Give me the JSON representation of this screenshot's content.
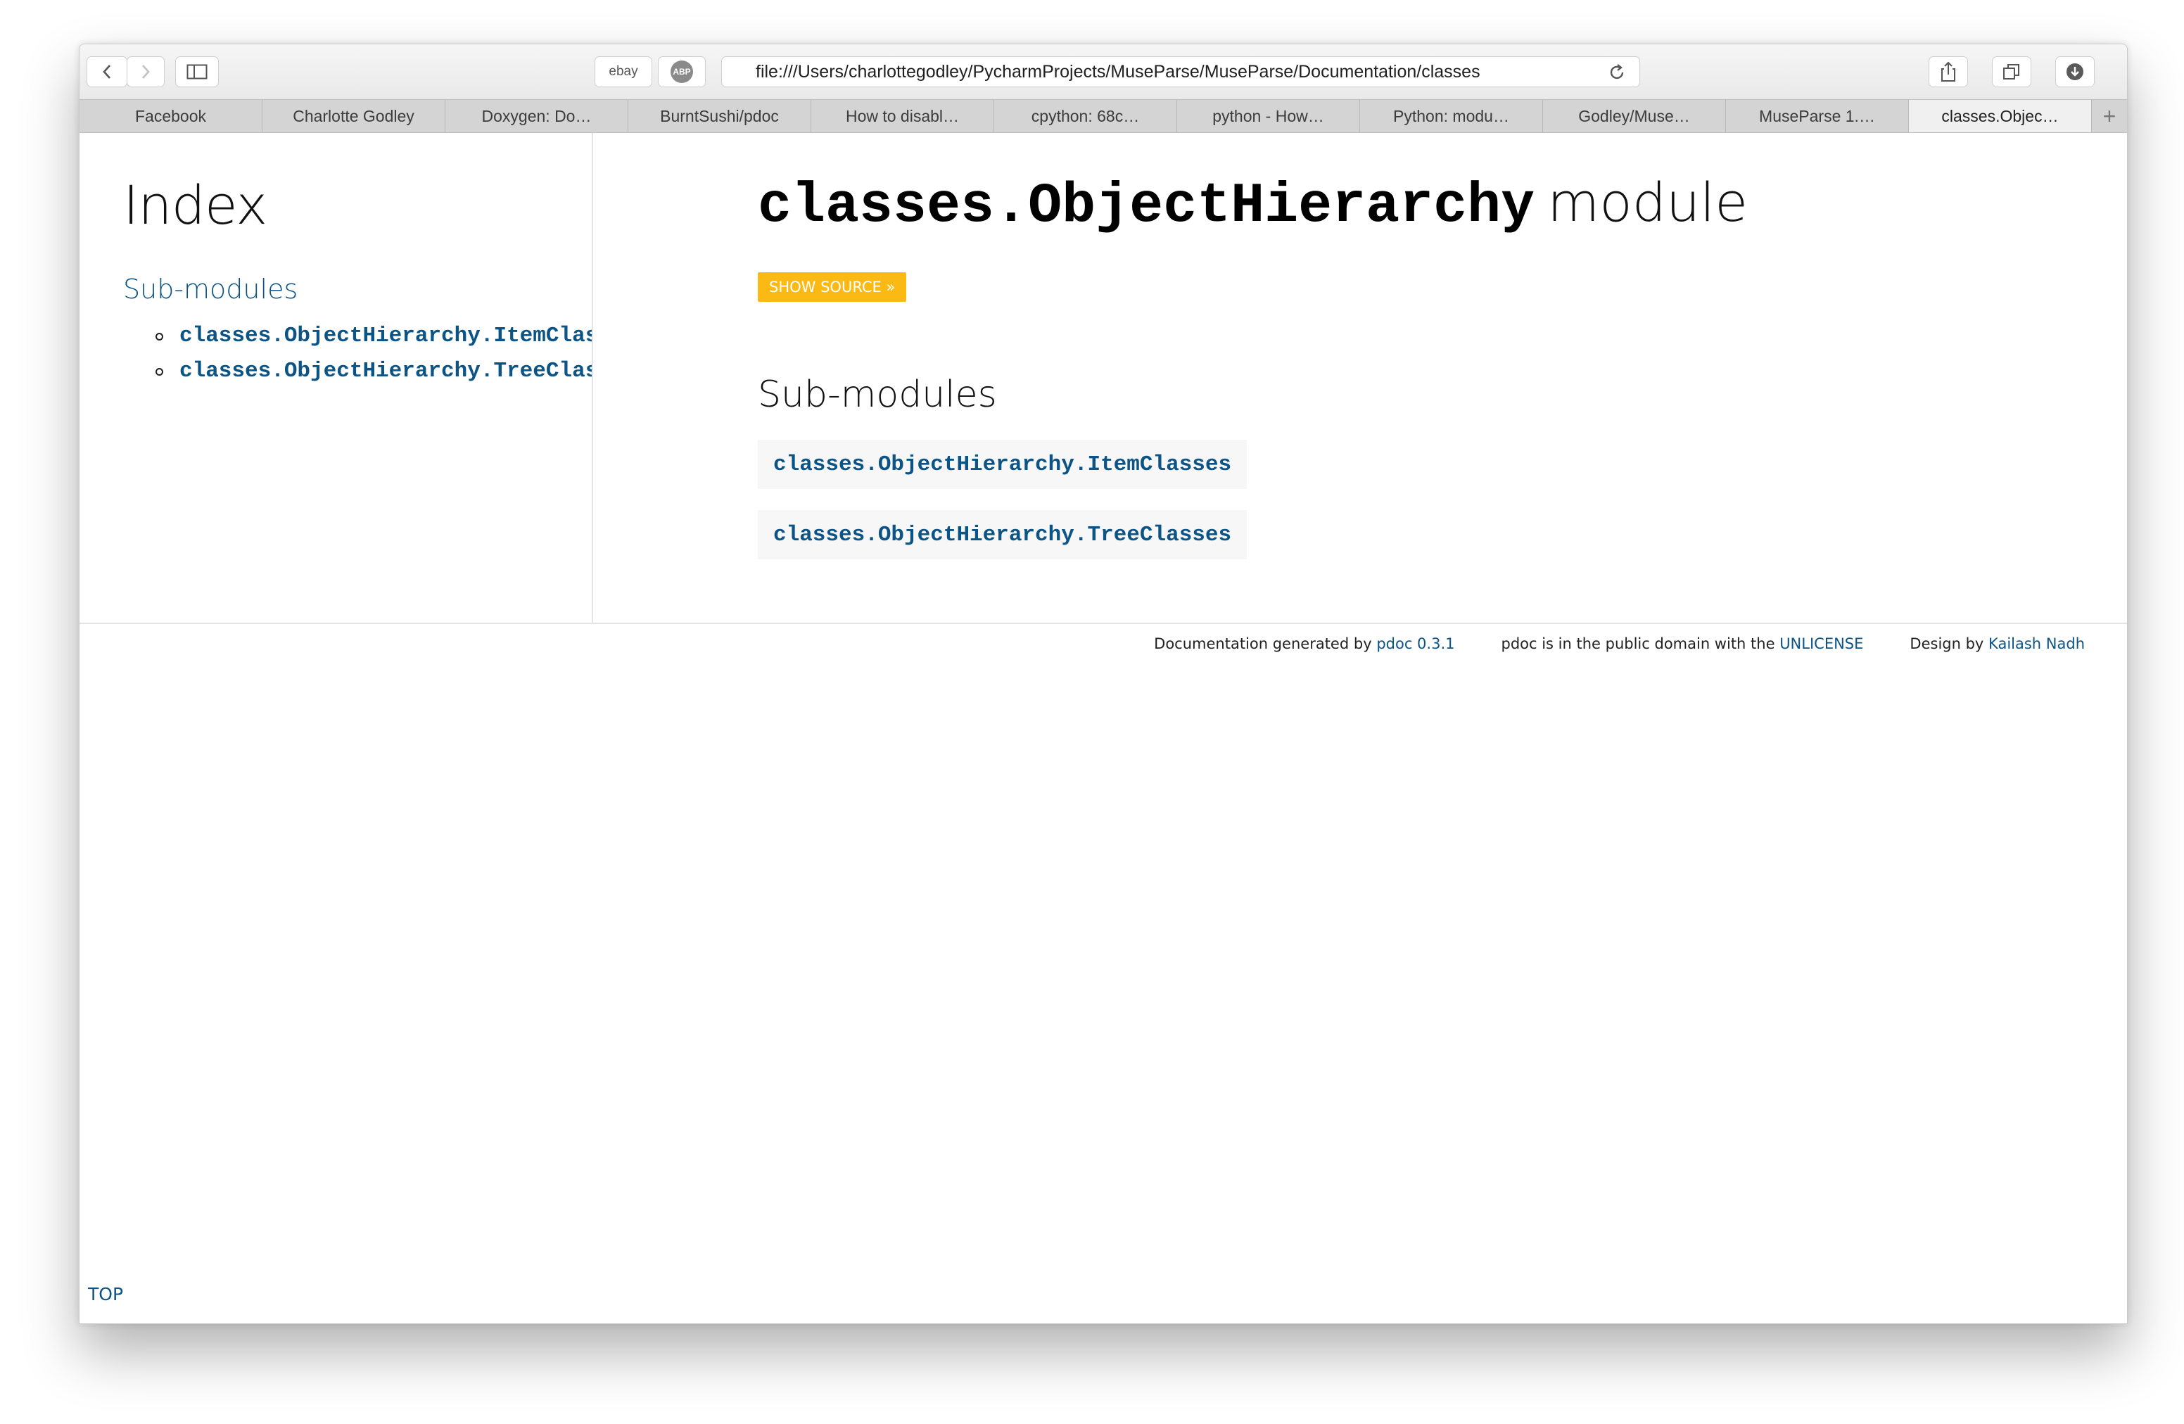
{
  "toolbar": {
    "ebay_label": "ebay",
    "abp_label": "ABP",
    "url": "file:///Users/charlottegodley/PycharmProjects/MuseParse/MuseParse/Documentation/classes"
  },
  "tabs": [
    {
      "label": "Facebook"
    },
    {
      "label": "Charlotte Godley"
    },
    {
      "label": "Doxygen: Do…"
    },
    {
      "label": "BurntSushi/pdoc"
    },
    {
      "label": "How to disabl…"
    },
    {
      "label": "cpython: 68c…"
    },
    {
      "label": "python - How…"
    },
    {
      "label": "Python: modu…"
    },
    {
      "label": "Godley/Muse…"
    },
    {
      "label": "MuseParse 1.…"
    },
    {
      "label": "classes.Objec…"
    }
  ],
  "sidebar": {
    "title": "Index",
    "submodules_heading": "Sub-modules",
    "items": [
      {
        "label": "classes.ObjectHierarchy.ItemClasses"
      },
      {
        "label": "classes.ObjectHierarchy.TreeClasses"
      }
    ]
  },
  "main": {
    "module_name": "classes.ObjectHierarchy",
    "module_word": "module",
    "show_source": "SHOW SOURCE »",
    "submodules_heading": "Sub-modules",
    "submodules": [
      {
        "label": "classes.ObjectHierarchy.ItemClasses"
      },
      {
        "label": "classes.ObjectHierarchy.TreeClasses"
      }
    ]
  },
  "footer": {
    "generated_prefix": "Documentation generated by",
    "pdoc_link": "pdoc 0.3.1",
    "license_prefix": "pdoc is in the public domain with the",
    "license_link": "UNLICENSE",
    "design_prefix": "Design by",
    "design_link": "Kailash Nadh"
  },
  "top_link": "TOP",
  "colors": {
    "link": "#0b5485",
    "show_source_bg": "#fbb913",
    "tab_bar": "#d4d4d4"
  }
}
